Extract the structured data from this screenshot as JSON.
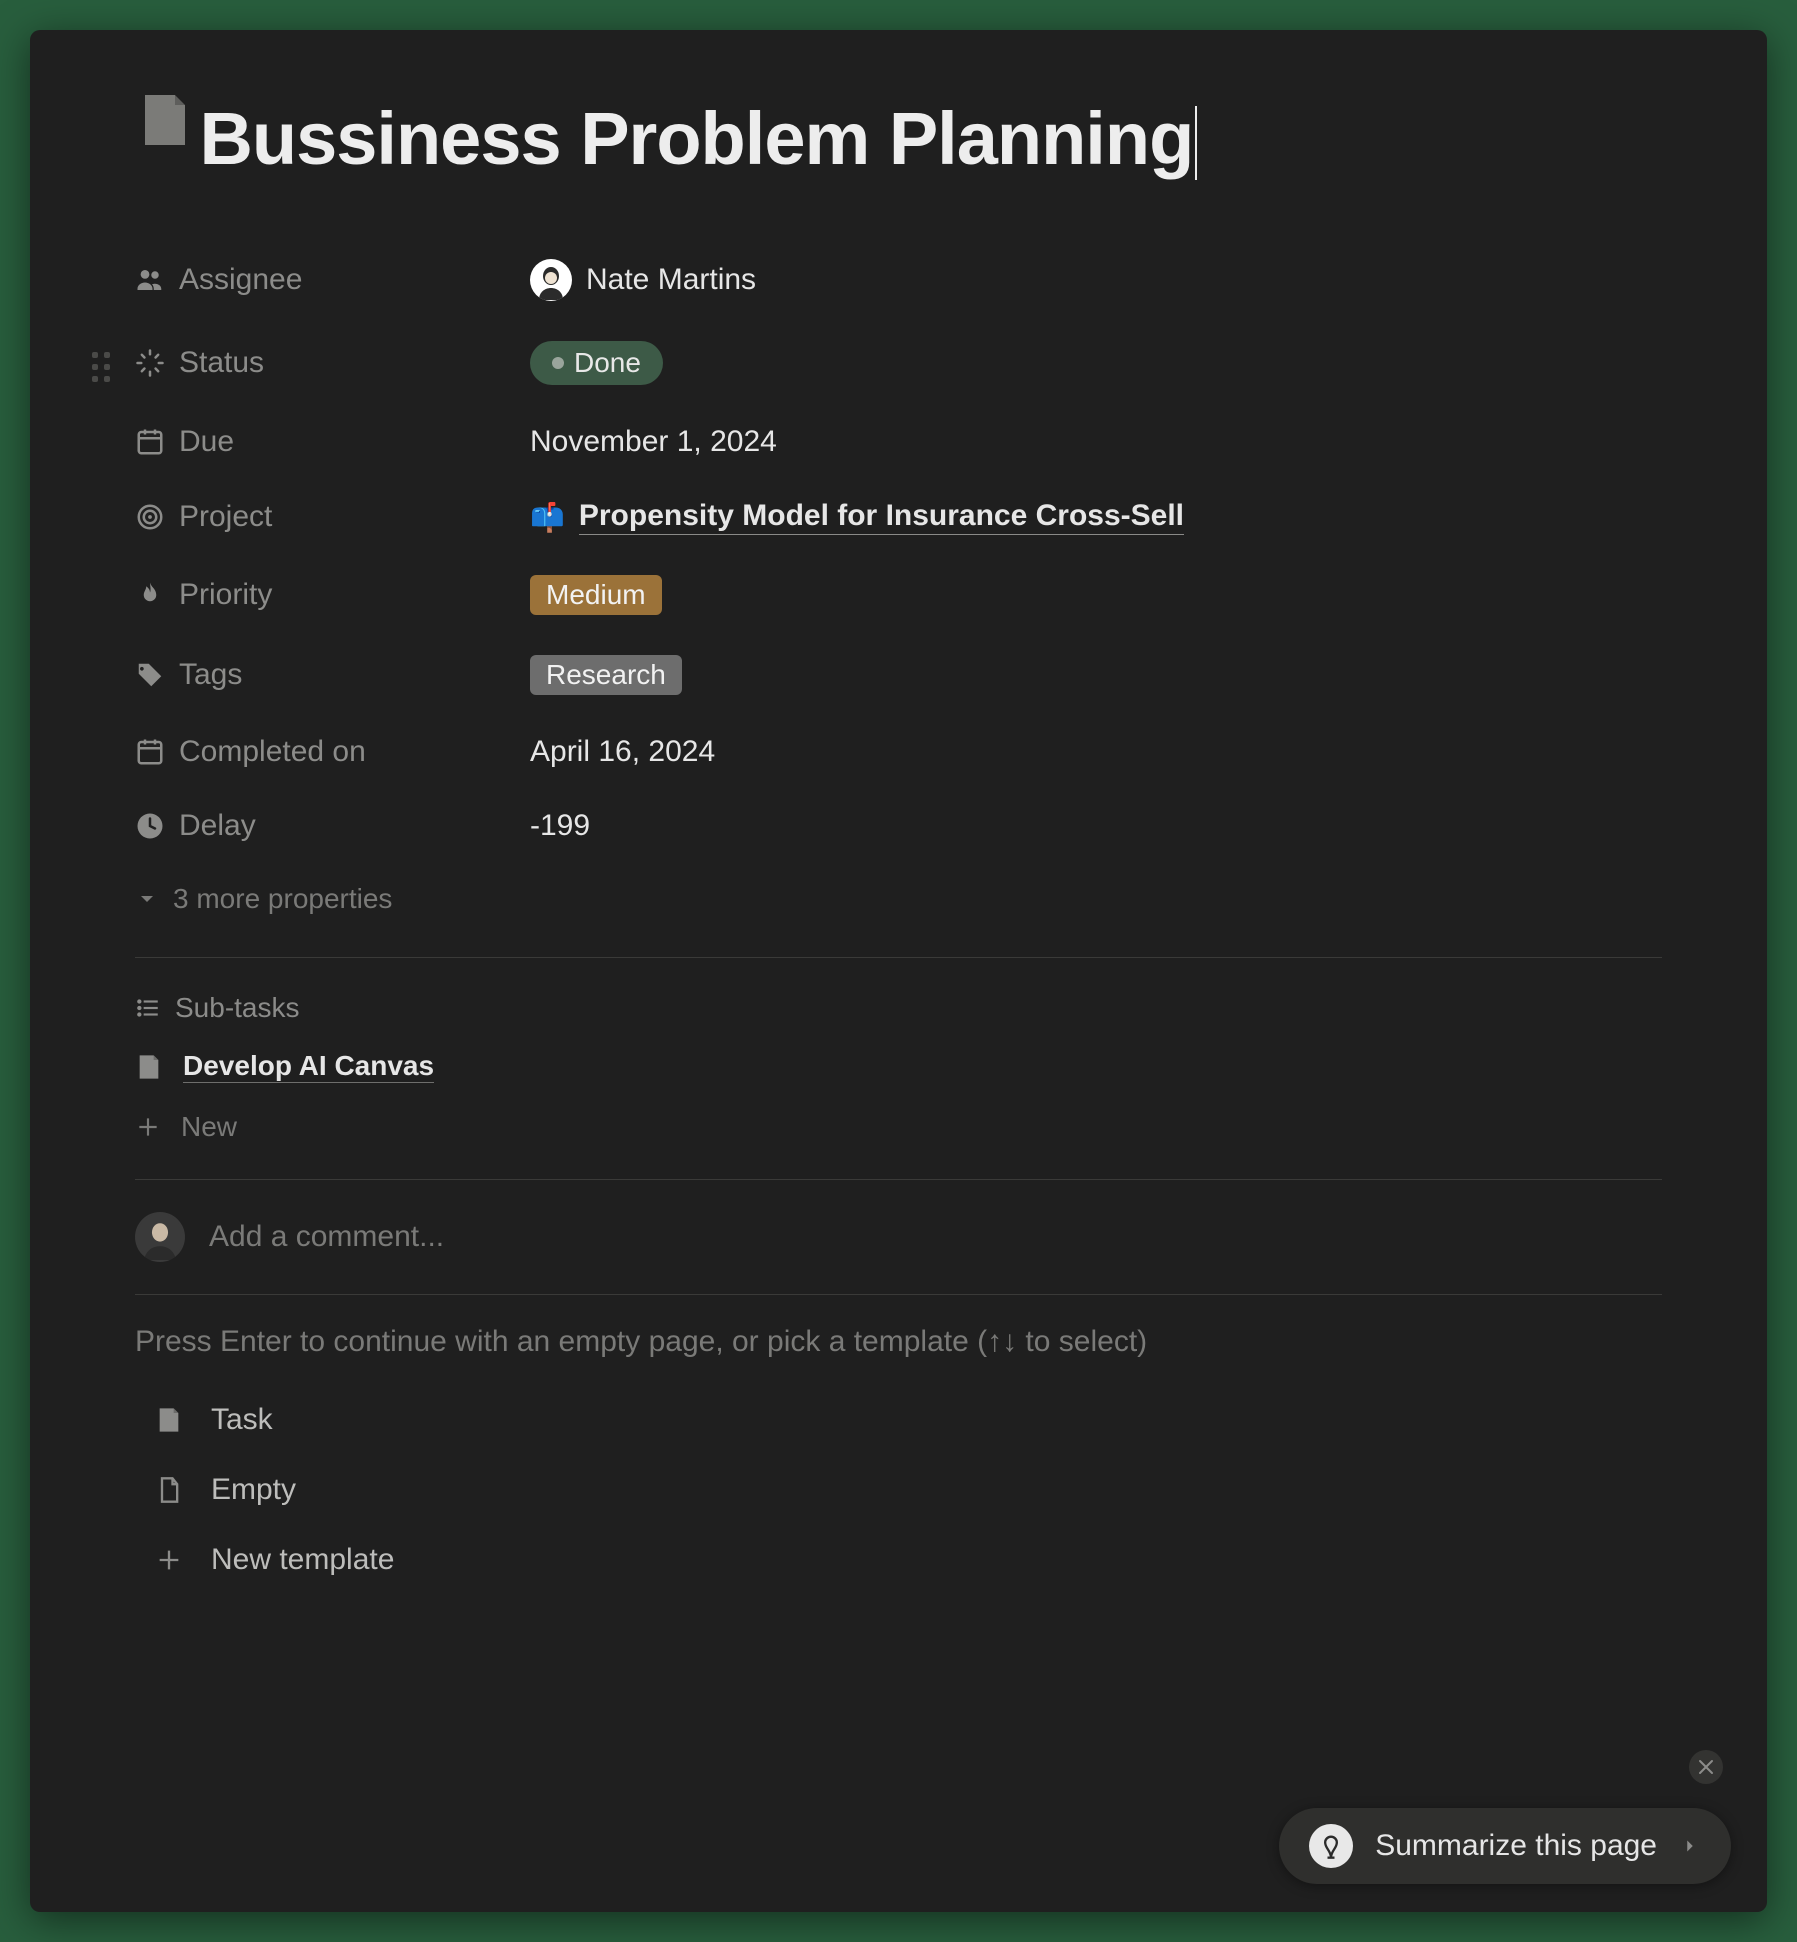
{
  "page": {
    "title": "Bussiness Problem Planning"
  },
  "properties": {
    "assignee": {
      "label": "Assignee",
      "value": "Nate Martins"
    },
    "status": {
      "label": "Status",
      "value": "Done"
    },
    "due": {
      "label": "Due",
      "value": "November 1, 2024"
    },
    "project": {
      "label": "Project",
      "emoji": "📫",
      "value": "Propensity Model for Insurance Cross-Sell"
    },
    "priority": {
      "label": "Priority",
      "value": "Medium"
    },
    "tags": {
      "label": "Tags",
      "value": "Research"
    },
    "completed": {
      "label": "Completed on",
      "value": "April 16, 2024"
    },
    "delay": {
      "label": "Delay",
      "value": "-199"
    },
    "more": {
      "label": "3 more properties"
    }
  },
  "subtasks": {
    "header": "Sub-tasks",
    "items": [
      {
        "title": "Develop AI Canvas"
      }
    ],
    "new_label": "New"
  },
  "comments": {
    "placeholder": "Add a comment..."
  },
  "templates": {
    "hint": "Press Enter to continue with an empty page, or pick a template (↑↓ to select)",
    "items": [
      {
        "label": "Task"
      },
      {
        "label": "Empty"
      },
      {
        "label": "New template"
      }
    ]
  },
  "summarize": {
    "label": "Summarize this page"
  }
}
